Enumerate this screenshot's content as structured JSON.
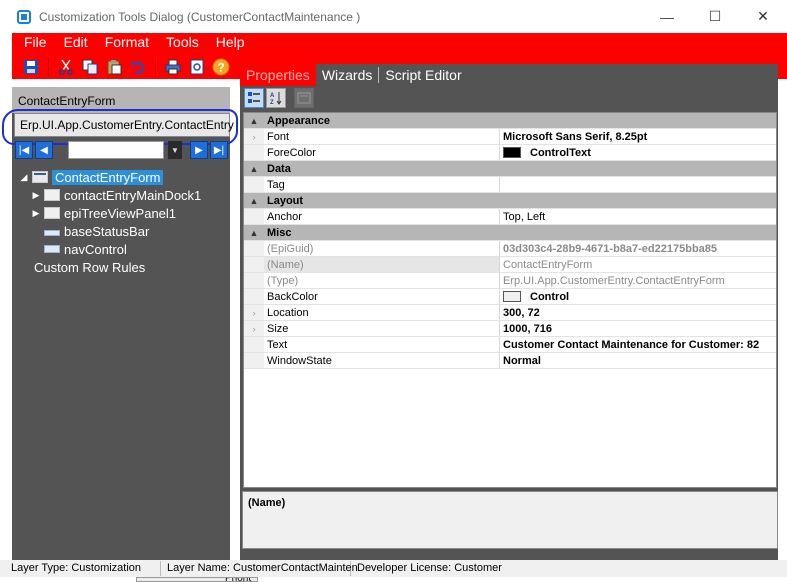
{
  "window": {
    "title": "Customization Tools Dialog  (CustomerContactMaintenance )",
    "minimize": "—",
    "maximize": "☐",
    "close": "✕"
  },
  "menu": [
    "File",
    "Edit",
    "Format",
    "Tools",
    "Help"
  ],
  "toolbar_icons": [
    "save-icon",
    "cut-icon",
    "copy-icon",
    "paste-icon",
    "undo-icon",
    "print-icon",
    "print-preview-icon",
    "help-icon"
  ],
  "left": {
    "header": "ContactEntryForm",
    "combo_value": "Erp.UI.App.CustomerEntry.ContactEntry",
    "tree": [
      {
        "label": "ContactEntryForm",
        "level": 0,
        "expander": "◢",
        "icon": "form",
        "selected": true
      },
      {
        "label": "contactEntryMainDock1",
        "level": 1,
        "expander": "▶",
        "icon": "dock",
        "selected": false
      },
      {
        "label": "epiTreeViewPanel1",
        "level": 1,
        "expander": "▶",
        "icon": "dock",
        "selected": false
      },
      {
        "label": "baseStatusBar",
        "level": 1,
        "expander": "",
        "icon": "status",
        "selected": false
      },
      {
        "label": "navControl",
        "level": 1,
        "expander": "",
        "icon": "nav",
        "selected": false
      }
    ],
    "custom_rules": "Custom Row Rules"
  },
  "tabs": [
    {
      "label": "Properties",
      "active": true
    },
    {
      "label": "Wizards",
      "active": false
    },
    {
      "label": "Script Editor",
      "active": false
    }
  ],
  "grid": {
    "rows": [
      {
        "type": "cat",
        "gutter": "▲",
        "name": "Appearance",
        "value": ""
      },
      {
        "type": "prop",
        "gutter": "›",
        "name": "Font",
        "value": "Microsoft Sans Serif, 8.25pt",
        "bold": true
      },
      {
        "type": "prop",
        "gutter": "",
        "name": "ForeColor",
        "value": "ControlText",
        "bold": true,
        "swatch": "#000000"
      },
      {
        "type": "cat",
        "gutter": "▲",
        "name": "Data",
        "value": ""
      },
      {
        "type": "prop",
        "gutter": "",
        "name": "Tag",
        "value": ""
      },
      {
        "type": "cat",
        "gutter": "▲",
        "name": "Layout",
        "value": ""
      },
      {
        "type": "prop",
        "gutter": "",
        "name": "Anchor",
        "value": "Top, Left"
      },
      {
        "type": "cat",
        "gutter": "▲",
        "name": "Misc",
        "value": ""
      },
      {
        "type": "ro",
        "gutter": "",
        "name": "(EpiGuid)",
        "value": "03d303c4-28b9-4671-b8a7-ed22175bba85",
        "bold": true
      },
      {
        "type": "ro",
        "gutter": "",
        "name": "(Name)",
        "value": "ContactEntryForm",
        "selected": true
      },
      {
        "type": "ro",
        "gutter": "",
        "name": "(Type)",
        "value": "Erp.UI.App.CustomerEntry.ContactEntryForm"
      },
      {
        "type": "prop",
        "gutter": "",
        "name": "BackColor",
        "value": "Control",
        "bold": true,
        "swatch": "#f0f0f0"
      },
      {
        "type": "prop",
        "gutter": "›",
        "name": "Location",
        "value": "300, 72",
        "bold": true
      },
      {
        "type": "prop",
        "gutter": "›",
        "name": "Size",
        "value": "1000, 716",
        "bold": true
      },
      {
        "type": "prop",
        "gutter": "",
        "name": "Text",
        "value": "Customer Contact Maintenance for Customer: 82",
        "bold": true
      },
      {
        "type": "prop",
        "gutter": "",
        "name": "WindowState",
        "value": "Normal",
        "bold": true
      }
    ]
  },
  "description": "(Name)",
  "status": {
    "layer_type": "Layer Type:  Customization",
    "layer_name": "Layer Name:  CustomerContactMainten",
    "license": "Developer License:  Customer"
  },
  "under_text": "Priorit"
}
